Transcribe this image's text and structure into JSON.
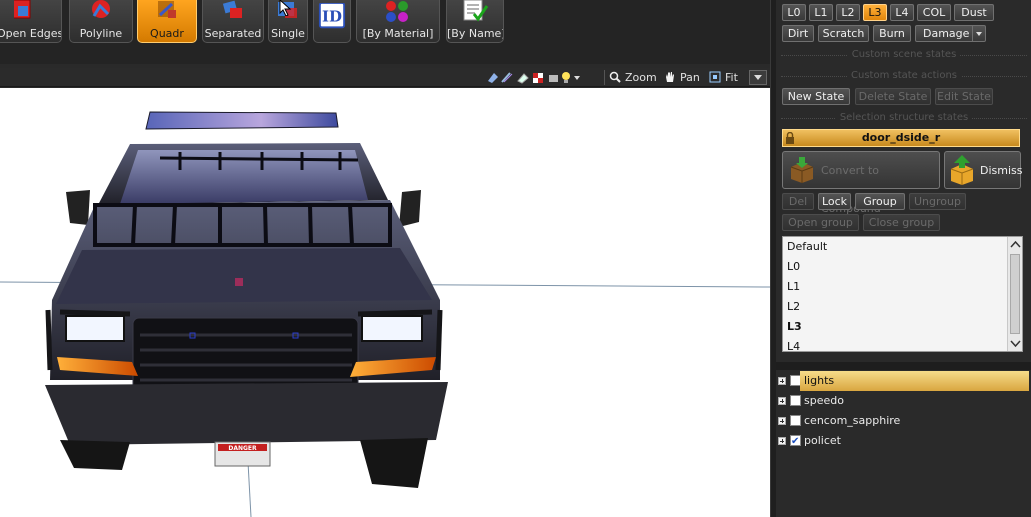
{
  "toolbar": {
    "buttons": [
      {
        "label": "Open Edges",
        "icon": "open-edges-icon"
      },
      {
        "label": "Polyline",
        "icon": "polyline-icon"
      },
      {
        "label": "Quadr",
        "icon": "quad-icon",
        "active": true
      },
      {
        "label": "Separated",
        "icon": "separated-icon"
      },
      {
        "label": "Single",
        "icon": "single-icon"
      },
      {
        "label": "",
        "icon": "id-icon"
      },
      {
        "label": "[By Material]",
        "icon": "material-icon"
      },
      {
        "label": "[By Name]",
        "icon": "by-name-icon"
      }
    ]
  },
  "viewport_bar": {
    "zoom_label": "Zoom",
    "pan_label": "Pan",
    "fit_label": "Fit"
  },
  "viewport": {
    "danger_sign_text": "DANGER"
  },
  "lod_buttons": [
    {
      "label": "L0"
    },
    {
      "label": "L1"
    },
    {
      "label": "L2"
    },
    {
      "label": "L3",
      "active": true
    },
    {
      "label": "L4"
    },
    {
      "label": "COL"
    },
    {
      "label": "Dust"
    }
  ],
  "damage_buttons": [
    {
      "label": "Dirt"
    },
    {
      "label": "Scratch"
    },
    {
      "label": "Burn"
    },
    {
      "label": "Damage"
    }
  ],
  "sections": {
    "custom_scene_states": "Custom scene states",
    "custom_state_actions": "Custom state actions",
    "selection_structure_states": "Selection structure states"
  },
  "state_actions": {
    "new_state": "New State",
    "delete_state": "Delete State",
    "edit_state": "Edit State"
  },
  "selected_state": "door_dside_r",
  "compound": {
    "convert_label": "Convert to Compound",
    "dismiss_label": "Dismiss"
  },
  "group_actions": {
    "del": "Del",
    "lock": "Lock",
    "group": "Group",
    "ungroup": "Ungroup",
    "open_group": "Open group",
    "close_group": "Close group"
  },
  "state_list": {
    "items": [
      {
        "label": "Default"
      },
      {
        "label": "L0"
      },
      {
        "label": "L1"
      },
      {
        "label": "L2"
      },
      {
        "label": "L3",
        "bold": true
      },
      {
        "label": "L4"
      }
    ]
  },
  "tree": {
    "items": [
      {
        "label": "lights",
        "checked": false,
        "selected": true
      },
      {
        "label": "speedo",
        "checked": false
      },
      {
        "label": "cencom_sapphire",
        "checked": false
      },
      {
        "label": "policet",
        "checked": true
      }
    ]
  },
  "colors": {
    "accent": "#f2a21c",
    "panel_bg": "#2a2a2a",
    "viewport_bg": "#ffffff"
  }
}
